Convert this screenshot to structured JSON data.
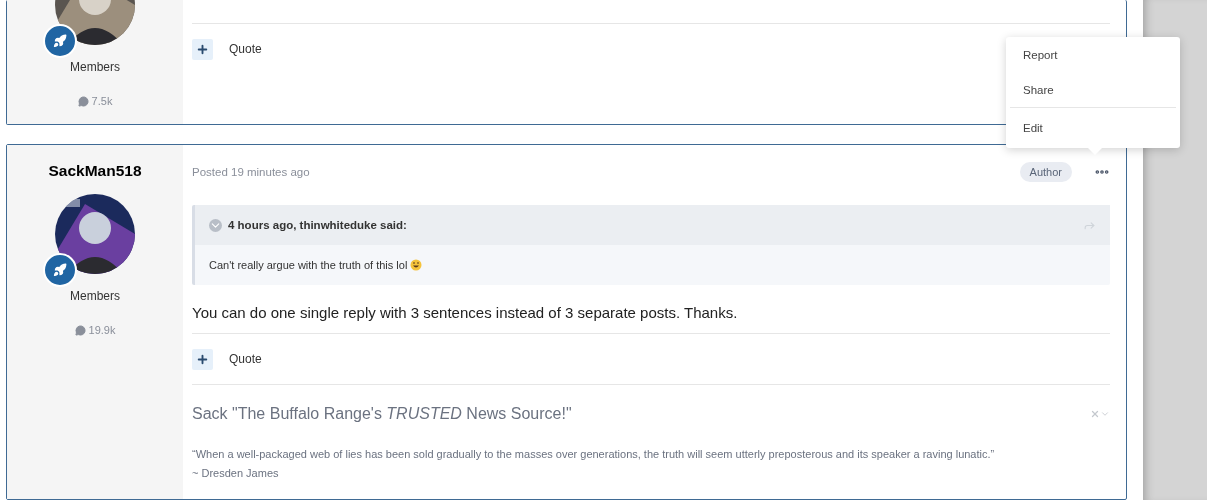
{
  "posts": [
    {
      "role": "Members",
      "post_count": "7.5k",
      "quote_action": "Quote"
    },
    {
      "username": "SackMan518",
      "role": "Members",
      "post_count": "19.9k",
      "posted": "Posted 19 minutes ago",
      "badge": "Author",
      "quote": {
        "citation": "4 hours ago, thinwhiteduke said:",
        "text": "Can't really argue with the truth of this lol"
      },
      "body": "You can do one single reply with 3 sentences instead of 3 separate posts. Thanks.",
      "quote_action": "Quote",
      "signature": {
        "title": "Sack \"The Buffalo Range's *TRUSTED* News Source!\"",
        "quote": "“When a well-packaged web of lies has been sold gradually to the masses over generations, the truth will seem utterly preposterous and its speaker a raving lunatic.”",
        "attribution": "~ Dresden James"
      }
    }
  ],
  "menu": {
    "items": [
      {
        "label": "Report",
        "divider_above": false
      },
      {
        "label": "Share",
        "divider_above": false
      },
      {
        "label": "Edit",
        "divider_above": true
      }
    ]
  }
}
